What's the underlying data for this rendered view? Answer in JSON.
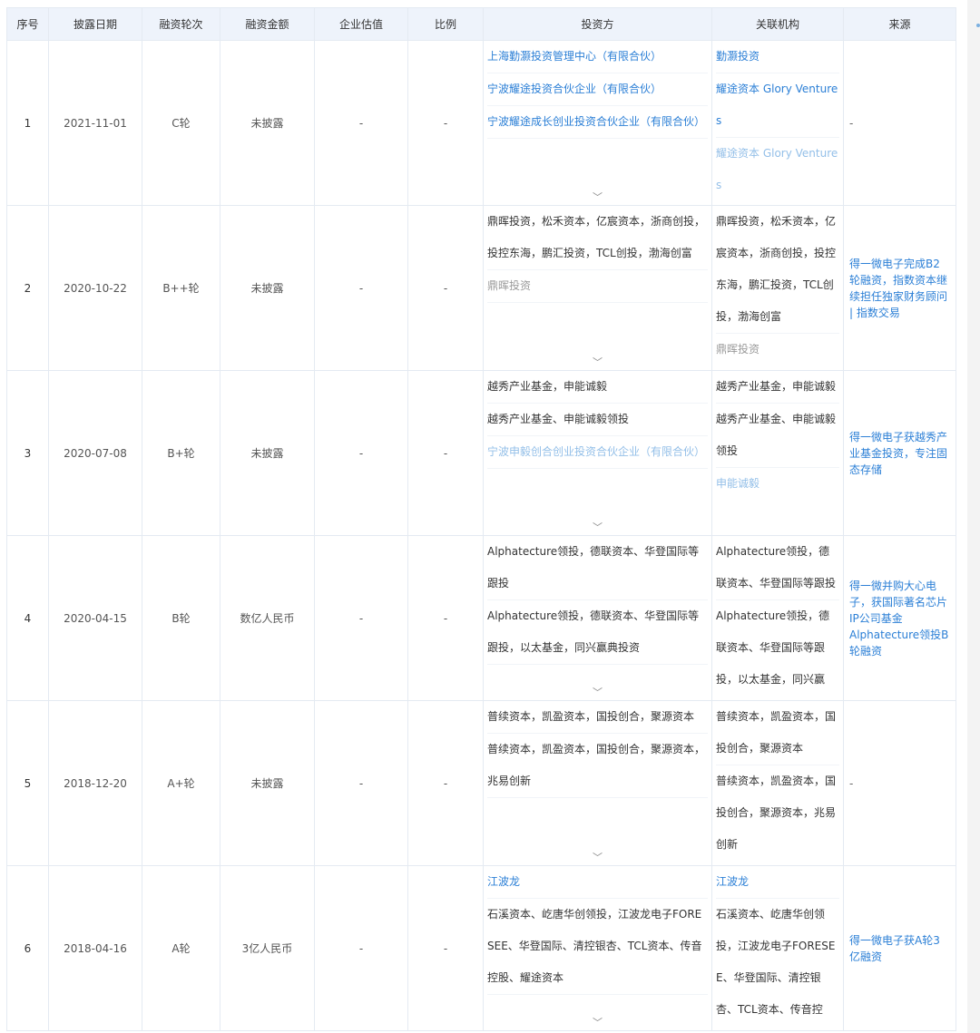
{
  "headers": [
    "序号",
    "披露日期",
    "融资轮次",
    "融资金额",
    "企业估值",
    "比例",
    "投资方",
    "关联机构",
    "来源"
  ],
  "expand_glyph": "﹀",
  "rows": [
    {
      "index": "1",
      "date": "2021-11-01",
      "round": "C轮",
      "amount": "未披露",
      "valuation": "-",
      "ratio": "-",
      "investors": [
        {
          "text": "上海勤灏投资管理中心（有限合伙）",
          "style": "link"
        },
        {
          "text": "宁波耀途投资合伙企业（有限合伙）",
          "style": "link"
        },
        {
          "text": "宁波耀途成长创业投资合伙企业（有限合伙）",
          "style": "link"
        }
      ],
      "orgs": [
        {
          "text": "勤灏投资",
          "style": "link"
        },
        {
          "text": "耀途资本 Glory Ventures",
          "style": "link"
        },
        {
          "text": "耀途资本 Glory Ventures",
          "style": "link faded"
        }
      ],
      "source": "-"
    },
    {
      "index": "2",
      "date": "2020-10-22",
      "round": "B++轮",
      "amount": "未披露",
      "valuation": "-",
      "ratio": "-",
      "investors": [
        {
          "text": "鼎晖投资，松禾资本，亿宸资本，浙商创投，投控东海，鹏汇投资，TCL创投，渤海创富",
          "style": "plain"
        },
        {
          "text": "鼎晖投资",
          "style": "faded"
        }
      ],
      "orgs": [
        {
          "text": "鼎晖投资，松禾资本，亿宸资本，浙商创投，投控东海，鹏汇投资，TCL创投，渤海创富",
          "style": "plain"
        },
        {
          "text": "鼎晖投资",
          "style": "faded"
        }
      ],
      "source": "得一微电子完成B2轮融资，指数资本继续担任独家财务顾问 | 指数交易"
    },
    {
      "index": "3",
      "date": "2020-07-08",
      "round": "B+轮",
      "amount": "未披露",
      "valuation": "-",
      "ratio": "-",
      "investors": [
        {
          "text": "越秀产业基金，申能诚毅",
          "style": "plain"
        },
        {
          "text": "越秀产业基金、申能诚毅领投",
          "style": "plain"
        },
        {
          "text": "宁波申毅创合创业投资合伙企业（有限合伙）",
          "style": "link faded"
        }
      ],
      "orgs": [
        {
          "text": "越秀产业基金，申能诚毅",
          "style": "plain"
        },
        {
          "text": "越秀产业基金、申能诚毅领投",
          "style": "plain"
        },
        {
          "text": "申能诚毅",
          "style": "link faded"
        }
      ],
      "source": "得一微电子获越秀产业基金投资，专注固态存储"
    },
    {
      "index": "4",
      "date": "2020-04-15",
      "round": "B轮",
      "amount": "数亿人民币",
      "valuation": "-",
      "ratio": "-",
      "investors": [
        {
          "text": "Alphatecture领投，德联资本、华登国际等跟投",
          "style": "plain"
        },
        {
          "text": "Alphatecture领投，德联资本、华登国际等跟投，以太基金，同兴赢典投资",
          "style": "plain"
        }
      ],
      "orgs": [
        {
          "text": "Alphatecture领投，德联资本、华登国际等跟投",
          "style": "plain"
        },
        {
          "text": "Alphatecture领投，德联资本、华登国际等跟投，以太基金，同兴赢",
          "style": "plain"
        }
      ],
      "source": "得一微并购大心电子，获国际著名芯片IP公司基金Alphatecture领投B轮融资"
    },
    {
      "index": "5",
      "date": "2018-12-20",
      "round": "A+轮",
      "amount": "未披露",
      "valuation": "-",
      "ratio": "-",
      "investors": [
        {
          "text": "普续资本，凯盈资本，国投创合，聚源资本",
          "style": "plain"
        },
        {
          "text": "普续资本，凯盈资本，国投创合，聚源资本，兆易创新",
          "style": "plain"
        }
      ],
      "orgs": [
        {
          "text": "普续资本，凯盈资本，国投创合，聚源资本",
          "style": "plain"
        },
        {
          "text": "普续资本，凯盈资本，国投创合，聚源资本，兆易创新",
          "style": "plain"
        }
      ],
      "source": "-"
    },
    {
      "index": "6",
      "date": "2018-04-16",
      "round": "A轮",
      "amount": "3亿人民币",
      "valuation": "-",
      "ratio": "-",
      "investors": [
        {
          "text": "江波龙",
          "style": "link"
        },
        {
          "text": "石溪资本、屹唐华创领投，江波龙电子FORESEE、华登国际、清控银杏、TCL资本、传音控股、耀途资本",
          "style": "plain"
        }
      ],
      "orgs": [
        {
          "text": "江波龙",
          "style": "link"
        },
        {
          "text": "石溪资本、屹唐华创领投，江波龙电子FORESEE、华登国际、清控银杏、TCL资本、传音控",
          "style": "plain"
        }
      ],
      "source": "得一微电子获A轮3亿融资"
    }
  ]
}
